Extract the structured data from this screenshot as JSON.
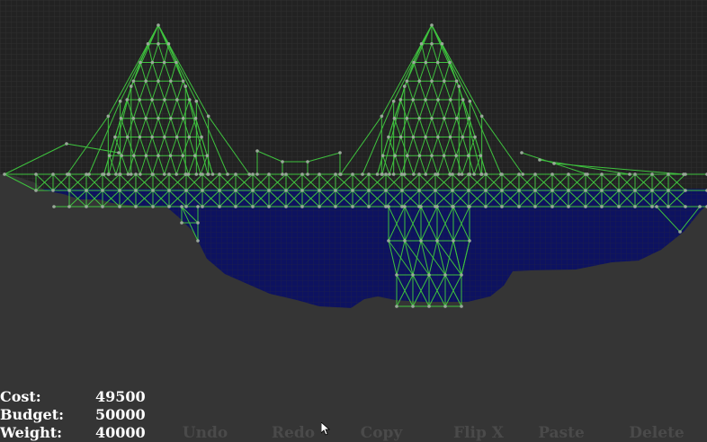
{
  "stats": {
    "cost_label": "Cost:",
    "cost_value": "49500",
    "budget_label": "Budget:",
    "budget_value": "50000",
    "weight_label": "Weight:",
    "weight_value": "40000"
  },
  "toolbar": {
    "undo": "Undo",
    "redo": "Redo",
    "copy": "Copy",
    "flip_x": "Flip X",
    "paste": "Paste",
    "delete": "Delete"
  },
  "colors": {
    "sky": "#232323",
    "grid": "#2e2e2e",
    "ground": "#353535",
    "water": "#0d1260",
    "beam": "#3ec23e",
    "joint": "#9aa89a",
    "disabled_text": "#4a4a4a"
  }
}
